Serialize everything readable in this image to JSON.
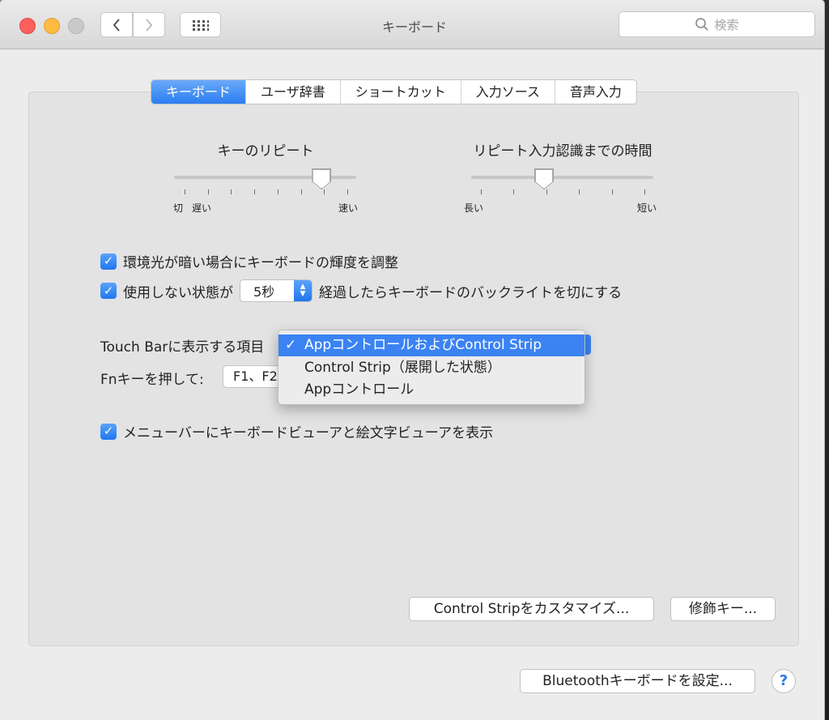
{
  "window": {
    "title": "キーボード"
  },
  "search": {
    "placeholder": "検索"
  },
  "tabs": [
    "キーボード",
    "ユーザ辞書",
    "ショートカット",
    "入力ソース",
    "音声入力"
  ],
  "key_repeat": {
    "title": "キーのリピート",
    "labels": [
      "切",
      "遅い",
      "速い"
    ],
    "level": 0.81
  },
  "delay_until_repeat": {
    "title": "リピート入力認識までの時間",
    "labels": [
      "長い",
      "短い"
    ],
    "level": 0.4
  },
  "options": {
    "adjust_brightness": {
      "label": "環境光が暗い場合にキーボードの輝度を調整",
      "checked": true
    },
    "backlight": {
      "label_before": "使用しない状態が",
      "value": "5秒",
      "label_after": "経過したらキーボードのバックライトを切にする",
      "checked": true
    }
  },
  "touch_bar": {
    "label": "Touch Barに表示する項目",
    "options": [
      {
        "label": "AppコントロールおよびControl Strip",
        "selected": true
      },
      {
        "label": "Control Strip（展開した状態）",
        "selected": false
      },
      {
        "label": "Appコントロール",
        "selected": false
      }
    ],
    "check_glyph": "✓"
  },
  "fn_key": {
    "label": "Fnキーを押して:",
    "value": "F1、F2"
  },
  "menubar_viewer": {
    "label": "メニューバーにキーボードビューアと絵文字ビューアを表示",
    "checked": true
  },
  "buttons": {
    "customize_strip": "Control Stripをカスタマイズ...",
    "modifier_keys": "修飾キー...",
    "bluetooth_setup": "Bluetoothキーボードを設定...",
    "help": "?"
  },
  "icons": {
    "back": "‹",
    "forward": "›",
    "grid": "grid-icon",
    "search": "magnifier"
  }
}
